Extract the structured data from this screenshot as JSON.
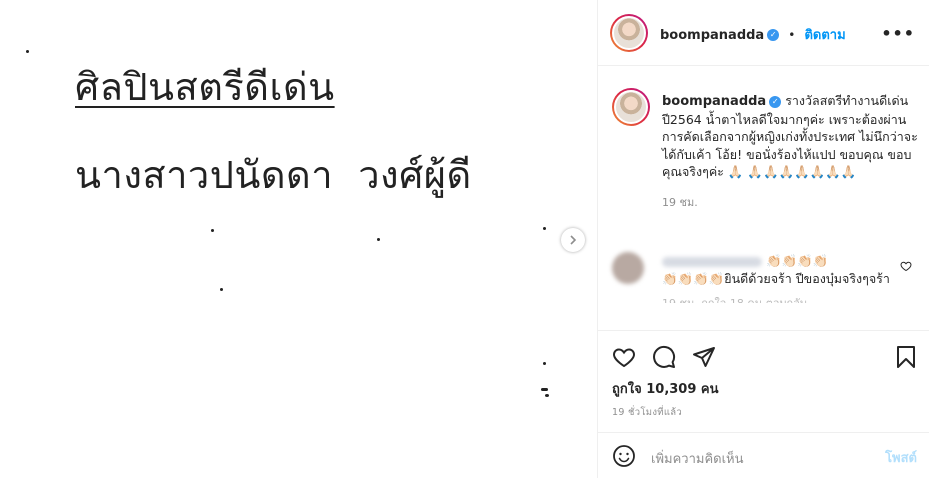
{
  "post_image": {
    "line1": "ศิลปินสตรีดีเด่น",
    "line2": "นางสาวปนัดดา  วงศ์ผู้ดี"
  },
  "header": {
    "username": "boompanadda",
    "separator": "•",
    "follow_label": "ติดตาม",
    "more_icon": "more-horizontal-icon"
  },
  "caption": {
    "username": "boompanadda",
    "text": "รางวัลสตรีทำงานดีเด่น ปี2564 น้ำตาไหลดีใจมากๆค่ะ เพราะต้องผ่านการคัดเลือกจากผู้หญิงเก่งทั้งประเทศ ไม่นึกว่าจะได้กับเค้า โอ้ย! ขอนั่งร้องไห้แปป ขอบคุณ ขอบคุณจริงๆค่ะ 🙏🏻 🙏🏻🙏🏻🙏🏻🙏🏻🙏🏻🙏🏻🙏🏻",
    "time": "19 ชม."
  },
  "comment": {
    "text_prefix": "👏🏻👏🏻👏🏻👏🏻",
    "text_main": "👏🏻👏🏻👏🏻👏🏻ยินดีด้วยจร้า ปีของบุ๋มจริงๆจร้า",
    "meta": "19 ชม.   ถูกใจ 18 คน   ตอบกลับ"
  },
  "actions": {
    "likes_label": "ถูกใจ 10,309 คน",
    "ago": "19 ชั่วโมงที่แล้ว"
  },
  "add_comment": {
    "placeholder": "เพิ่มความคิดเห็น",
    "post_label": "โพสต์"
  },
  "colors": {
    "accent": "#0095f6",
    "verified": "#3897f0",
    "muted": "#8e8e8e",
    "post_disabled": "#b2dffc"
  }
}
